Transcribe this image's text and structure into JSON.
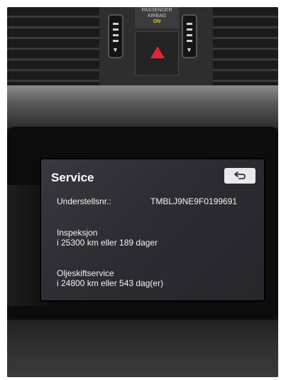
{
  "dashboard": {
    "airbag_line1": "PASSENGER",
    "airbag_line2": "AIRBAG",
    "airbag_status": "ON"
  },
  "screen": {
    "title": "Service",
    "back_icon": "back-arrow-icon",
    "vin_label": "Understellsnr.:",
    "vin_value": "TMBLJ9NE9F0199691",
    "inspection_title": "Inspeksjon",
    "inspection_detail": "i 25300 km eller 189 dager",
    "oil_title": "Oljeskiftservice",
    "oil_detail": "i 24800 km eller 543 dag(er)"
  },
  "colors": {
    "screen_bg": "#2c2c33",
    "hazard_red": "#e0263a",
    "airbag_on": "#f2c21b"
  }
}
